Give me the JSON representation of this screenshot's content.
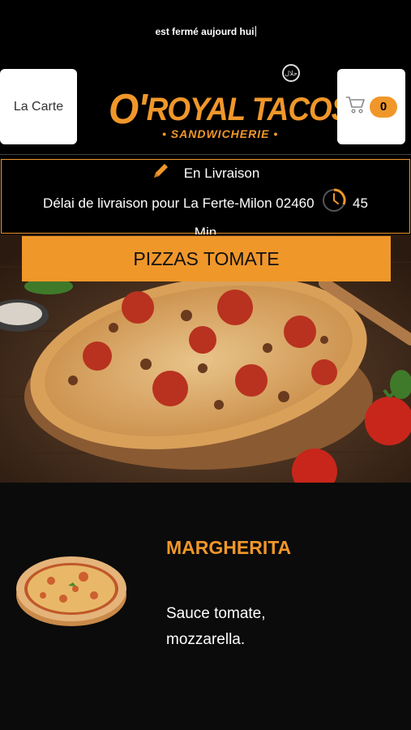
{
  "notice": {
    "text": "est fermé aujourd hui"
  },
  "header": {
    "menu_button_label": "La Carte",
    "logo_title": "ROYAL TACOS",
    "logo_o": "O'",
    "logo_subtitle": "• SANDWICHERIE •",
    "halal_badge": "حلال",
    "cart_count": "0"
  },
  "delivery": {
    "mode": "En Livraison",
    "delay_text": "Délai de livraison pour La Ferte-Milon 02460",
    "delay_value": "45",
    "delay_unit": "Min"
  },
  "category": {
    "title": "PIZZAS TOMATE"
  },
  "items": [
    {
      "name": "MARGHERITA",
      "description": "Sauce tomate, mozzarella."
    }
  ],
  "colors": {
    "accent": "#f0972a",
    "background": "#000000"
  }
}
